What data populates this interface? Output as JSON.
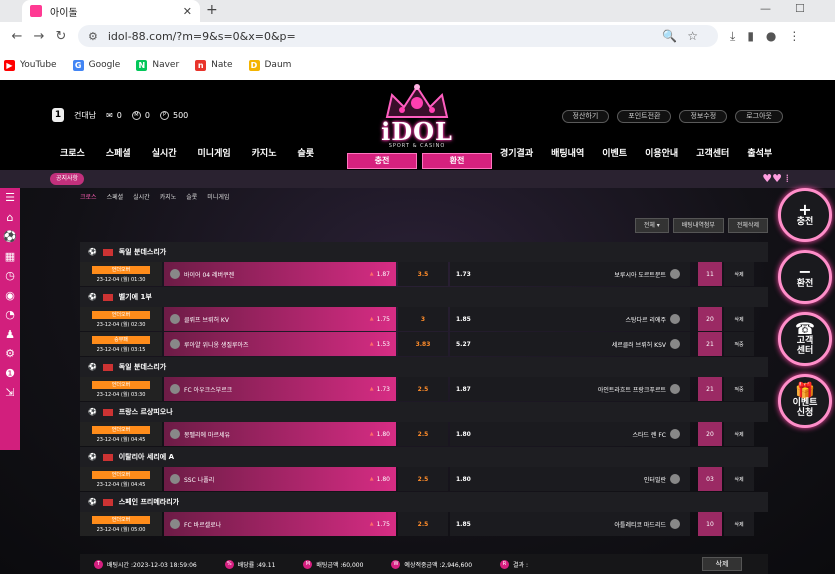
{
  "browser": {
    "tab_title": "아이돌",
    "url": "idol-88.com/?m=9&s=0&x=0&p=",
    "bookmarks": [
      "YouTube",
      "Google",
      "Naver",
      "Nate",
      "Daum"
    ]
  },
  "user": {
    "name": "건대남",
    "messages": "0",
    "m": "0",
    "points": "500",
    "level": "1"
  },
  "logo": {
    "text": "iDOL",
    "sub": "SPORT & CASINO"
  },
  "top_links": [
    "정산하기",
    "포인트전환",
    "정보수정",
    "로그아웃"
  ],
  "main_nav_left": [
    "크로스",
    "스페셜",
    "실시간",
    "미니게임",
    "카지노",
    "슬롯"
  ],
  "main_nav_right": [
    "경기결과",
    "배팅내역",
    "이벤트",
    "이용안내",
    "고객센터",
    "출석부"
  ],
  "deposit_label": "충전",
  "withdraw_label": "환전",
  "notice_label": "공지사항",
  "sport_tabs": [
    "크로스",
    "스페셜",
    "실시간",
    "카지노",
    "슬롯",
    "미니게임"
  ],
  "filters": {
    "select": "전체",
    "btn1": "배팅내역첨부",
    "btn2": "전체삭제"
  },
  "right_buttons": [
    {
      "icon": "+",
      "label": "충전"
    },
    {
      "icon": "−",
      "label": "환전"
    },
    {
      "icon": "☎",
      "label": "고객\n센터"
    },
    {
      "icon": "🎁",
      "label": "이벤트\n신청"
    }
  ],
  "leagues": [
    {
      "name": "독일 분데스리가",
      "games": [
        {
          "badge": "언더오버",
          "time": "23-12-04 (월) 01:30",
          "home": "바이어 04 레버쿠젠",
          "home_odd": "1.87",
          "draw": "3.5",
          "away_odd": "1.73",
          "away": "보루시아 도르트문트",
          "count": "11",
          "status": "삭제"
        }
      ]
    },
    {
      "name": "벨기에 1부",
      "games": [
        {
          "badge": "언더오버",
          "time": "23-12-04 (월) 02:30",
          "home": "클뤼프 브뤼허 KV",
          "home_odd": "1.75",
          "draw": "3",
          "away_odd": "1.85",
          "away": "스탕다르 리에주",
          "count": "20",
          "status": "삭제"
        },
        {
          "badge": "승무패",
          "time": "23-12-04 (월) 03:15",
          "home": "루아얄 위니옹 생질루아즈",
          "home_odd": "1.53",
          "draw": "3.83",
          "away_odd": "5.27",
          "away": "세르클러 브뤼허 KSV",
          "count": "21",
          "status": "적중"
        }
      ]
    },
    {
      "name": "독일 분데스리가",
      "games": [
        {
          "badge": "언더오버",
          "time": "23-12-04 (월) 03:30",
          "home": "FC 아우크스부르크",
          "home_odd": "1.73",
          "draw": "2.5",
          "away_odd": "1.87",
          "away": "아인트라흐트 프랑크푸르트",
          "count": "21",
          "status": "적중"
        }
      ]
    },
    {
      "name": "프랑스 르샹피오나",
      "games": [
        {
          "badge": "언더오버",
          "time": "23-12-04 (월) 04:45",
          "home": "몽펠리에 마르세유",
          "home_odd": "1.80",
          "draw": "2.5",
          "away_odd": "1.80",
          "away": "스타드 렌 FC",
          "count": "20",
          "status": "삭제"
        }
      ]
    },
    {
      "name": "이탈리아 세리에 A",
      "games": [
        {
          "badge": "언더오버",
          "time": "23-12-04 (월) 04:45",
          "home": "SSC 나폴리",
          "home_odd": "1.80",
          "draw": "2.5",
          "away_odd": "1.80",
          "away": "인터밀란",
          "count": "03",
          "status": "삭제"
        }
      ]
    },
    {
      "name": "스페인 프리메라리가",
      "games": [
        {
          "badge": "언더오버",
          "time": "23-12-04 (월) 05:00",
          "home": "FC 바르셀로나",
          "home_odd": "1.75",
          "draw": "2.5",
          "away_odd": "1.85",
          "away": "아틀레티코 마드리드",
          "count": "10",
          "status": "삭제"
        }
      ]
    }
  ],
  "betbar": {
    "time": "배팅시간 :2023-12-03 18:59:06",
    "rate": "배당률 :49.11",
    "amount": "배팅금액 :60,000",
    "expected": "예상적중금액 :2,946,600",
    "result": "결과 :",
    "delete": "삭제"
  },
  "colors": {
    "accent": "#d6217e",
    "orange": "#ff8c1a"
  }
}
